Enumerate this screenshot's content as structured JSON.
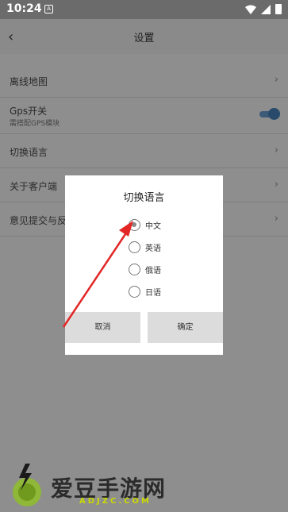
{
  "status": {
    "time": "10:24",
    "notification_glyph": "A"
  },
  "header": {
    "title": "设置",
    "back_icon": "back-chevron-icon"
  },
  "settings": {
    "items": [
      {
        "label": "离线地图"
      },
      {
        "label": "Gps开关",
        "sub": "需搭配GPS模块",
        "toggle_on": true
      },
      {
        "label": "切换语言"
      },
      {
        "label": "关于客户端"
      },
      {
        "label": "意见提交与反"
      }
    ]
  },
  "dialog": {
    "title": "切换语言",
    "options": [
      {
        "label": "中文",
        "selected": true
      },
      {
        "label": "英语",
        "selected": false
      },
      {
        "label": "俄语",
        "selected": false
      },
      {
        "label": "日语",
        "selected": false
      }
    ],
    "cancel_label": "取消",
    "ok_label": "确定"
  },
  "watermark": {
    "text": "爱豆手游网",
    "url": "ADJZC.COM"
  },
  "colors": {
    "arrow": "#e32626",
    "scrim": "#8e8e8e",
    "toggle": "#2a4a6c"
  }
}
